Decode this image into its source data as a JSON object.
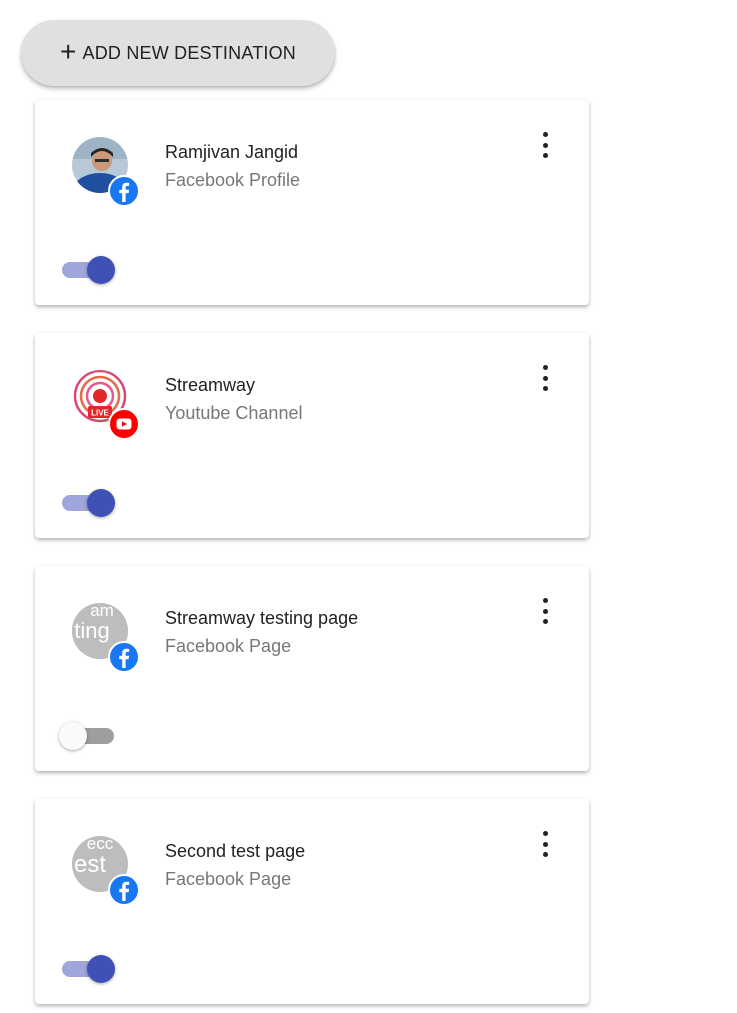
{
  "toolbar": {
    "add_icon": "plus-icon",
    "add_label": "ADD NEW DESTINATION"
  },
  "destinations": [
    {
      "title": "Ramjivan Jangid",
      "subtitle": "Facebook Profile",
      "platform_icon": "facebook-icon",
      "avatar": "profile-photo",
      "enabled": true
    },
    {
      "title": "Streamway",
      "subtitle": "Youtube Channel",
      "platform_icon": "youtube-icon",
      "avatar": "live-broadcast-logo",
      "avatar_text": "LIVE",
      "enabled": true
    },
    {
      "title": "Streamway testing page",
      "subtitle": "Facebook Page",
      "platform_icon": "facebook-icon",
      "avatar": "page-placeholder",
      "avatar_text": "am ting",
      "enabled": false
    },
    {
      "title": "Second test page",
      "subtitle": "Facebook Page",
      "platform_icon": "facebook-icon",
      "avatar": "page-placeholder",
      "avatar_text": "ecc est",
      "enabled": true
    }
  ],
  "colors": {
    "toggle_on_thumb": "#3f51b5",
    "toggle_on_track": "#9ea6dc",
    "toggle_off_thumb": "#fafafa",
    "toggle_off_track": "#9e9e9e",
    "facebook": "#1877f2",
    "youtube": "#ff0000"
  }
}
